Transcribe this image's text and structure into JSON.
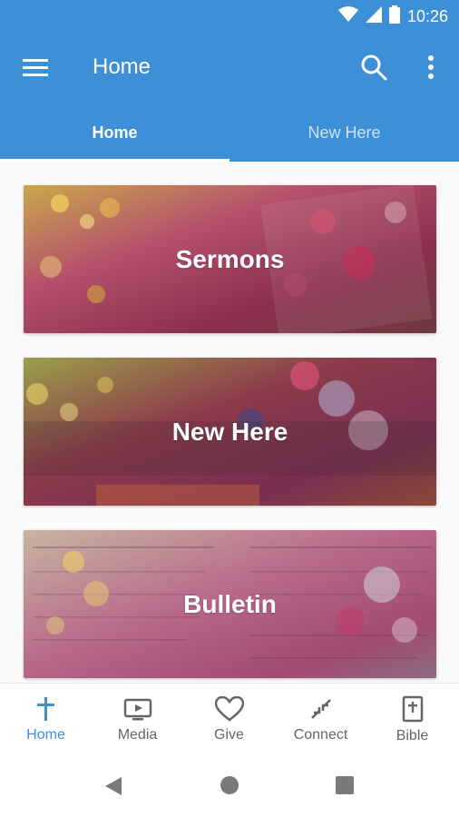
{
  "status": {
    "time": "10:26"
  },
  "appbar": {
    "title": "Home"
  },
  "tabs": [
    {
      "label": "Home",
      "active": true
    },
    {
      "label": "New Here",
      "active": false
    }
  ],
  "cards": [
    {
      "label": "Sermons"
    },
    {
      "label": "New Here"
    },
    {
      "label": "Bulletin"
    }
  ],
  "bottom_nav": [
    {
      "label": "Home",
      "icon": "cross-icon",
      "active": true
    },
    {
      "label": "Media",
      "icon": "tv-icon",
      "active": false
    },
    {
      "label": "Give",
      "icon": "heart-icon",
      "active": false
    },
    {
      "label": "Connect",
      "icon": "connect-arrows-icon",
      "active": false
    },
    {
      "label": "Bible",
      "icon": "bible-icon",
      "active": false
    }
  ],
  "colors": {
    "primary": "#3d8fd6",
    "tab_inactive": "#cfe4f8",
    "nav_inactive": "#666666"
  }
}
